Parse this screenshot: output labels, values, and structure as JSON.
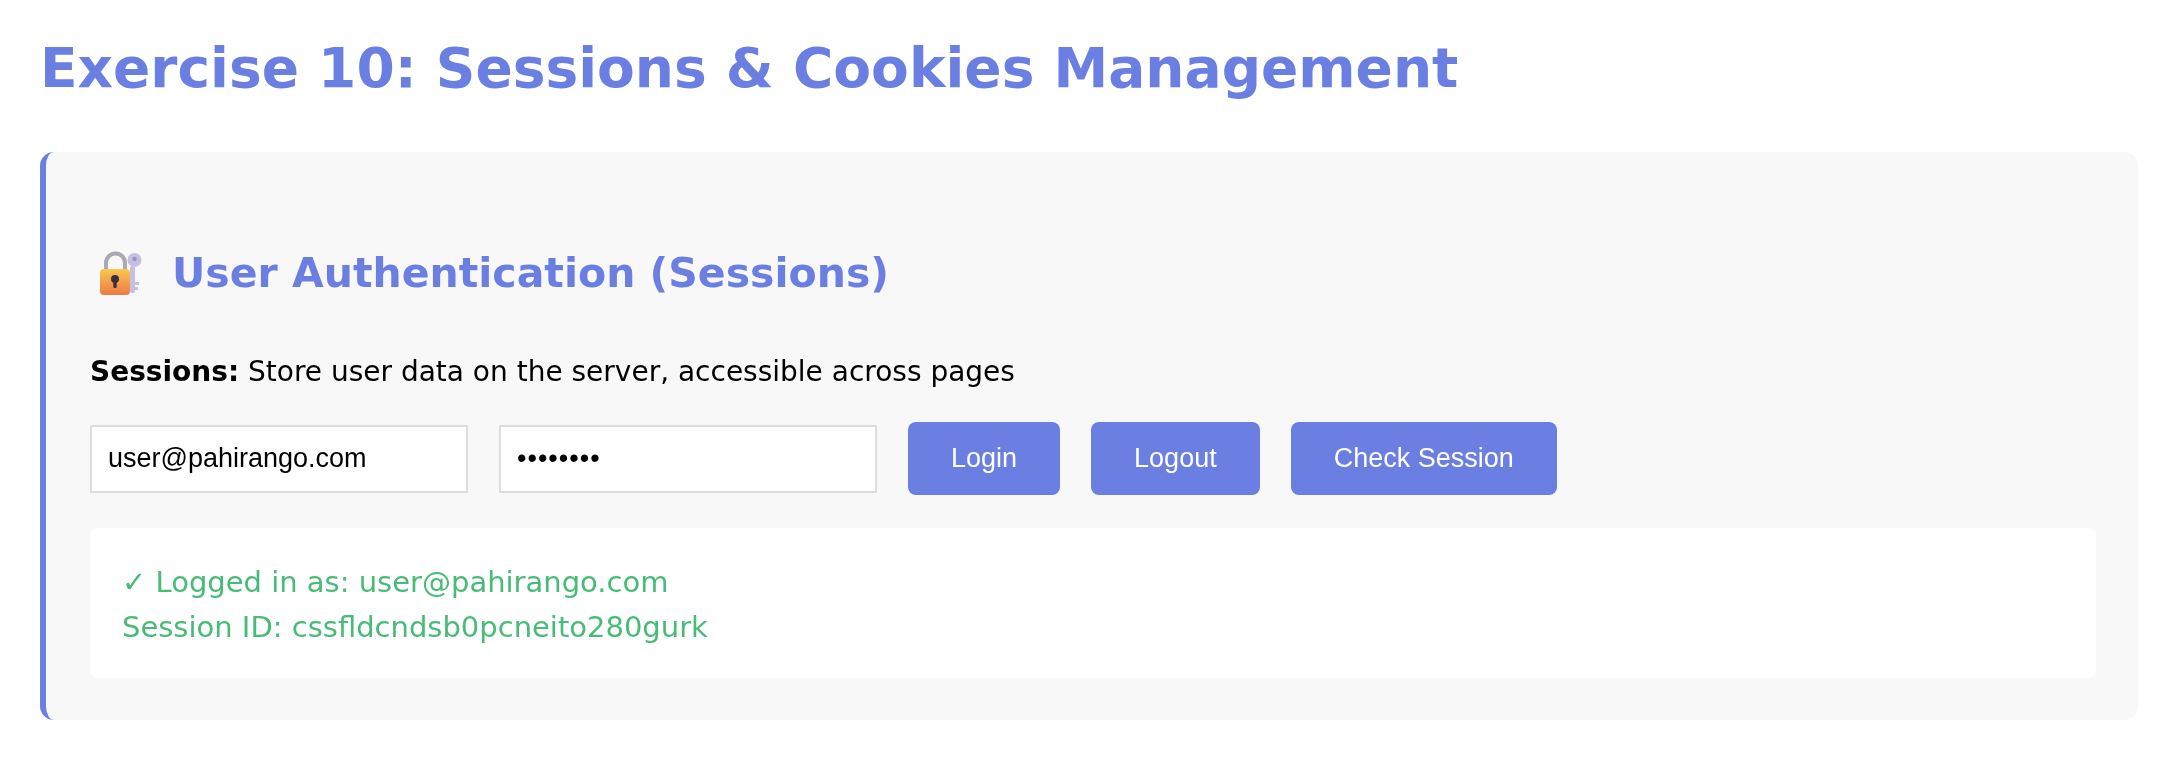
{
  "page": {
    "title": "Exercise 10: Sessions & Cookies Management"
  },
  "section": {
    "heading": "User Authentication (Sessions)",
    "description": "**Sessions:** Store user data on the server, accessible across pages",
    "fields": [
      {
        "kind": "text",
        "value": "user@pahirango.com"
      },
      {
        "kind": "secret",
        "value": "••••••••"
      }
    ],
    "buttons": [
      {
        "label": "Login"
      },
      {
        "label": "Logout"
      },
      {
        "label": "Check Session"
      }
    ],
    "result": {
      "success": true,
      "lines": [
        "✓ Logged in as: user@pahirango.com",
        "Session ID: cssfldcndsb0pcneito280gurk"
      ]
    }
  }
}
